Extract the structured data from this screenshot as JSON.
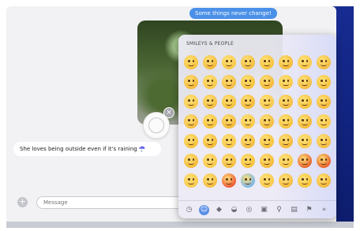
{
  "conversation": {
    "sent_message": "Some things never change!",
    "received_message": "She loves being outside even if it's raining ☂️"
  },
  "composer": {
    "placeholder": "Message",
    "plus_label": "+"
  },
  "emoji_picker": {
    "category_title": "SMILEYS & PEOPLE",
    "emojis": [
      "😀",
      "😃",
      "😄",
      "😁",
      "😆",
      "😅",
      "😂",
      "😎",
      "🤣",
      "😊",
      "😇",
      "🙂",
      "🙃",
      "😉",
      "😌",
      "😍",
      "🥰",
      "😘",
      "😗",
      "😙",
      "😚",
      "😋",
      "😛",
      "😝",
      "😜",
      "🤪",
      "🤨",
      "🧐",
      "🤓",
      "🤩",
      "🥳",
      "😏",
      "😒",
      "😞",
      "😔",
      "😟",
      "😕",
      "🙁",
      "😣",
      "😖",
      "😫",
      "😩",
      "🥺",
      "😢",
      "😭",
      "😤",
      "😠",
      "😡",
      "🤯",
      "😳",
      "🥵",
      "🥶",
      "😱",
      "😨",
      "😰",
      "😥"
    ],
    "toolbar_icons": [
      "clock-icon",
      "smiley-icon",
      "animal-icon",
      "food-icon",
      "ball-icon",
      "car-icon",
      "bulb-icon",
      "symbols-icon",
      "flag-icon",
      "more-icon"
    ],
    "toolbar_glyphs": [
      "◷",
      "☺",
      "◆",
      "◒",
      "◎",
      "▣",
      "♀",
      "▤",
      "⚑",
      "»"
    ]
  },
  "tapback": {
    "close_label": "×"
  },
  "colors": {
    "sent_bubble": "#4a90e8",
    "desktop": "#16288d"
  }
}
